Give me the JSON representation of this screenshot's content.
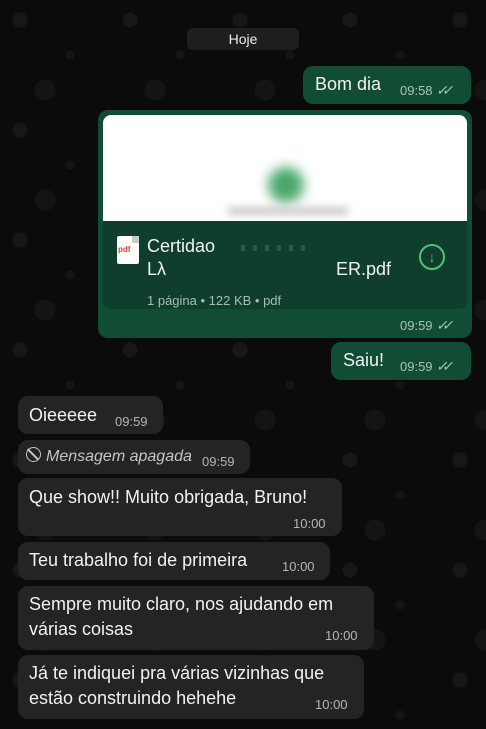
{
  "date_chip": "Hoje",
  "messages": [
    {
      "direction": "out",
      "text": "Bom dia",
      "time": "09:58",
      "status": "read"
    },
    {
      "direction": "out",
      "type": "document",
      "file_name_line1": "Certidao",
      "file_name_line2_end": "ER.pdf",
      "file_meta": "1 página • 122 KB • pdf",
      "file_type_icon": "pdf",
      "time": "09:59",
      "status": "read"
    },
    {
      "direction": "out",
      "text": "Saiu!",
      "time": "09:59",
      "status": "read"
    },
    {
      "direction": "in",
      "text": "Oieeeee",
      "time": "09:59"
    },
    {
      "direction": "in",
      "deleted": true,
      "text": "Mensagem apagada",
      "time": "09:59"
    },
    {
      "direction": "in",
      "text": "Que show!! Muito obrigada, Bruno!",
      "time": "10:00"
    },
    {
      "direction": "in",
      "text": "Teu trabalho foi de primeira",
      "time": "10:00"
    },
    {
      "direction": "in",
      "text_lines": [
        "Sempre muito claro, nos ajudando em",
        "várias coisas"
      ],
      "time": "10:00"
    },
    {
      "direction": "in",
      "text_lines": [
        "Já te indiquei pra várias vizinhas que",
        "estão construindo hehehe"
      ],
      "time": "10:00"
    }
  ],
  "icons": {
    "read": "double-check-icon",
    "download": "download-icon",
    "deleted": "blocked-icon"
  }
}
